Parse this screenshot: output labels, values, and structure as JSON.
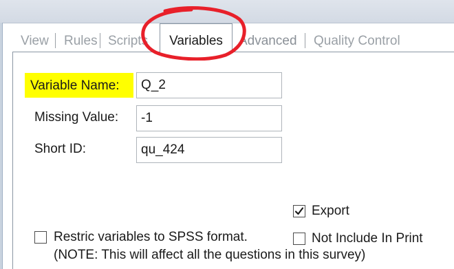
{
  "tabs": [
    {
      "label": "View",
      "active": false
    },
    {
      "label": "Rules",
      "active": false
    },
    {
      "label": "Scripts",
      "active": false
    },
    {
      "label": "Variables",
      "active": true
    },
    {
      "label": "Advanced",
      "active": false
    },
    {
      "label": "Quality Control",
      "active": false
    }
  ],
  "form": {
    "variable_name_label": "Variable Name:",
    "variable_name_value": "Q_2",
    "missing_value_label": "Missing Value:",
    "missing_value_value": "-1",
    "short_id_label": "Short ID:",
    "short_id_value": "qu_424"
  },
  "options": {
    "export_label": "Export",
    "export_checked": true,
    "not_include_label": "Not Include In Print",
    "not_include_checked": false,
    "restrict_label": "Restric variables to SPSS format.",
    "restrict_checked": false,
    "note": "(NOTE: This will affect all the questions in this survey)"
  },
  "colors": {
    "highlight": "#ffff00",
    "annotation": "#e8202a",
    "inactive_tab_text": "#9aa0a6"
  }
}
